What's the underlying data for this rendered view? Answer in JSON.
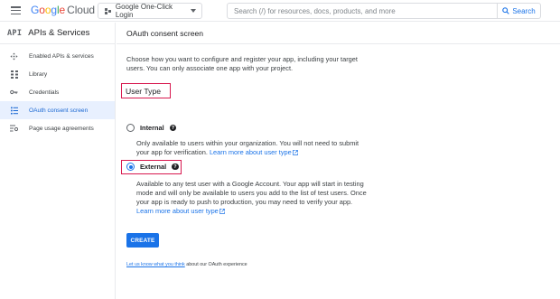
{
  "topbar": {
    "brand": {
      "letters": [
        "G",
        "o",
        "o",
        "g",
        "l",
        "e"
      ],
      "suffix": "Cloud"
    },
    "project_label": "Google One-Click Login",
    "search_placeholder": "Search (/) for resources, docs, products, and more",
    "search_button": "Search"
  },
  "sidebar": {
    "badge": "API",
    "title": "APIs & Services",
    "items": [
      {
        "label": "Enabled APIs & services",
        "icon": "diamond-arrows-icon",
        "active": false
      },
      {
        "label": "Library",
        "icon": "grid-icon",
        "active": false
      },
      {
        "label": "Credentials",
        "icon": "key-icon",
        "active": false
      },
      {
        "label": "OAuth consent screen",
        "icon": "consent-list-icon",
        "active": true
      },
      {
        "label": "Page usage agreements",
        "icon": "settings-list-icon",
        "active": false
      }
    ]
  },
  "main": {
    "title": "OAuth consent screen",
    "intro": "Choose how you want to configure and register your app, including your target users. You can only associate one app with your project.",
    "user_type_heading": "User Type",
    "options": {
      "internal": {
        "label": "Internal",
        "checked": false,
        "description": "Only available to users within your organization. You will not need to submit your app for verification.",
        "link": "Learn more about user type"
      },
      "external": {
        "label": "External",
        "checked": true,
        "description": "Available to any test user with a Google Account. Your app will start in testing mode and will only be available to users you add to the list of test users. Once your app is ready to push to production, you may need to verify your app.",
        "link": "Learn more about user type"
      }
    },
    "create_button": "CREATE",
    "feedback": {
      "link": "Let us know what you think",
      "text": "about our OAuth experience"
    }
  },
  "colors": {
    "accent": "#1a73e8",
    "highlight_border": "#d8184f",
    "active_nav_bg": "#e8f0fe"
  }
}
